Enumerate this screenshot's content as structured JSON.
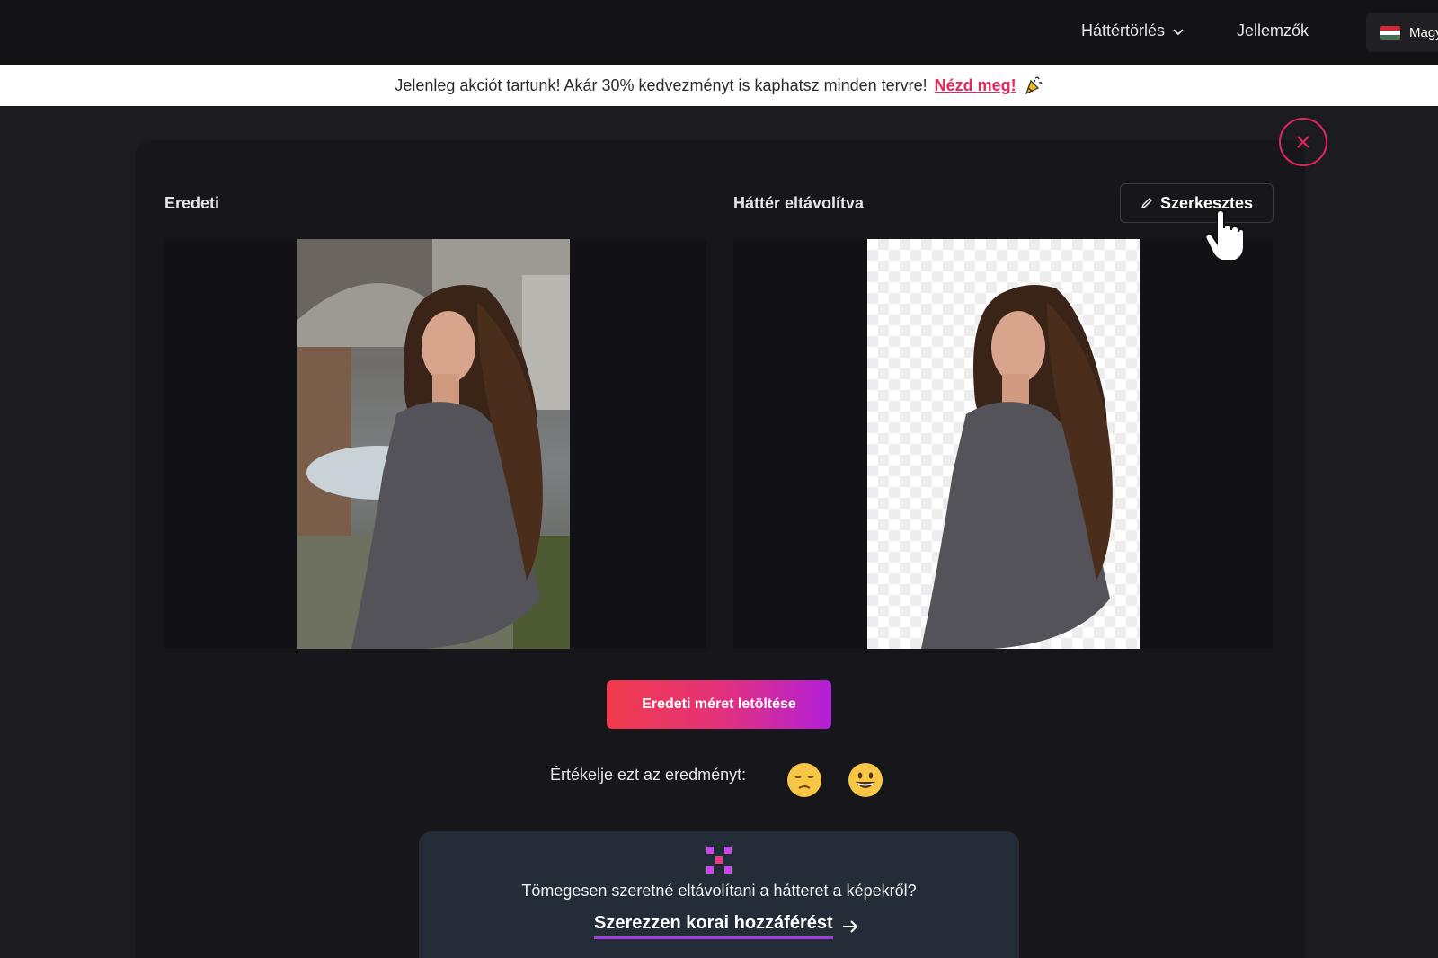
{
  "nav": {
    "background_removal": "Háttértörlés",
    "features": "Jellemzők",
    "language": "Magy",
    "flag_colors": [
      "#ce2939",
      "#ffffff",
      "#477050"
    ]
  },
  "promo": {
    "text": "Jelenleg akciót tartunk! Akár 30% kedvezményt is kaphatsz minden tervre!",
    "link": "Nézd meg!",
    "icon": "party-popper-icon",
    "link_color": "#e8265a"
  },
  "result": {
    "original_label": "Eredeti",
    "removed_label": "Háttér eltávolítva",
    "edit_button": "Szerkesztes",
    "download_button": "Eredeti méret letöltése",
    "rating_prompt": "Értékelje ezt az eredményt:",
    "rating_icons": [
      "pensive-face-icon",
      "grinning-face-icon"
    ]
  },
  "bulk": {
    "question": "Tömegesen szeretné eltávolítani a hátteret a képekről?",
    "link": "Szerezzen korai hozzáférést"
  },
  "colors": {
    "accent": "#e2265a",
    "gradient_start": "#f13b4b",
    "gradient_end": "#b21fd8"
  }
}
